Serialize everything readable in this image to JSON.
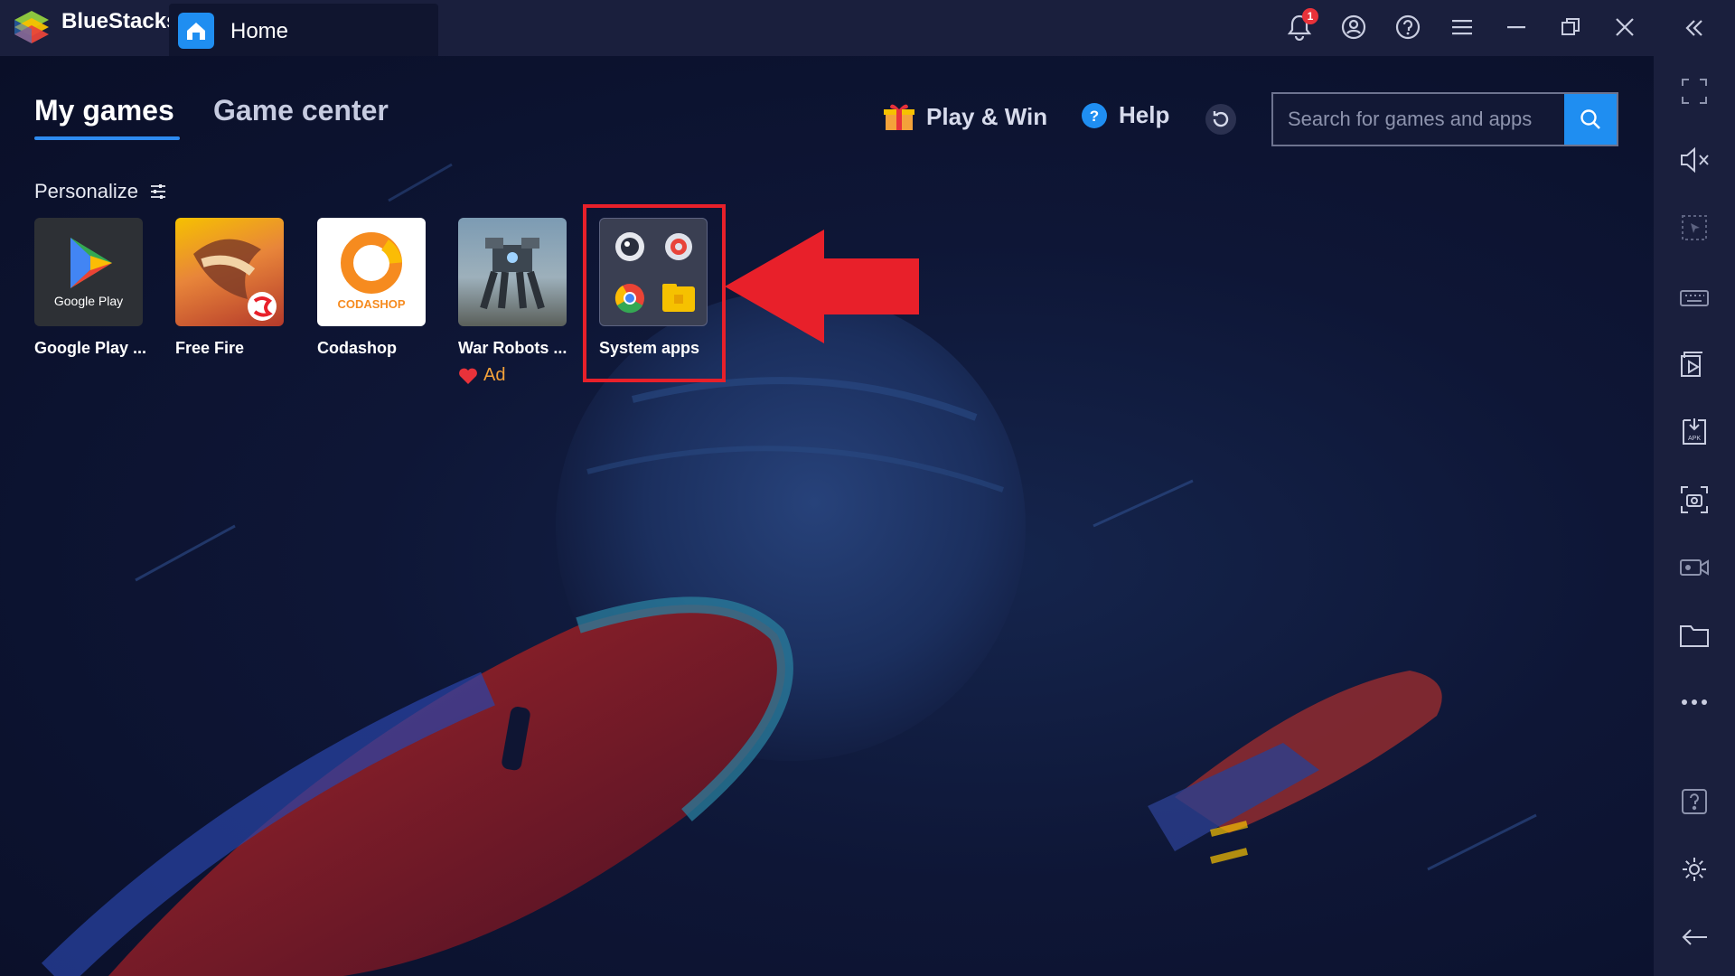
{
  "app": {
    "brand": "BlueStacks"
  },
  "tab": {
    "label": "Home"
  },
  "titlebar": {
    "notification_count": "1",
    "icons": [
      "bell-icon",
      "account-icon",
      "help-circle-icon",
      "menu-icon",
      "minimize-icon",
      "restore-icon",
      "close-icon",
      "collapse-icon"
    ]
  },
  "nav": {
    "tabs": [
      {
        "label": "My games",
        "active": true
      },
      {
        "label": "Game center",
        "active": false
      }
    ]
  },
  "actions": {
    "play_win": "Play & Win",
    "help": "Help"
  },
  "search": {
    "placeholder": "Search for games and apps"
  },
  "personalize": {
    "label": "Personalize"
  },
  "apps": [
    {
      "label": "Google Play ...",
      "icon": "google-play-icon"
    },
    {
      "label": "Free Fire",
      "icon": "free-fire-icon"
    },
    {
      "label": "Codashop",
      "icon": "codashop-icon"
    },
    {
      "label": "War Robots ...",
      "icon": "war-robots-icon",
      "ad": "Ad"
    },
    {
      "label": "System apps",
      "icon": "system-apps-folder-icon"
    }
  ],
  "app_texts": {
    "google_play_caption": "Google Play",
    "codashop_caption": "CODASHOP"
  },
  "sidebar": {
    "icons": [
      "fullscreen-icon",
      "mute-icon",
      "pointer-icon",
      "keyboard-icon",
      "media-manager-icon",
      "install-apk-icon",
      "screenshot-icon",
      "record-icon",
      "folder-icon",
      "more-icon",
      "help-icon",
      "settings-icon",
      "back-icon"
    ]
  },
  "colors": {
    "accent": "#1f8ef1",
    "highlight": "#e8202a",
    "background": "#0c1130"
  }
}
